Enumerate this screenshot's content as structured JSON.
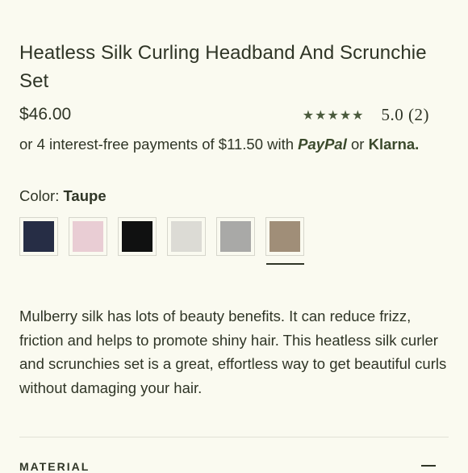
{
  "product": {
    "title": "Heatless Silk Curling Headband And Scrunchie Set",
    "price": "$46.00",
    "rating": {
      "stars": [
        "★",
        "★",
        "★",
        "★",
        "★"
      ],
      "text": "5.0 (2)",
      "star_color": "#4a5a3c"
    },
    "payments": {
      "prefix": "or 4 interest-free payments of $11.50 with ",
      "paypal": "PayPal",
      "middle": " or ",
      "klarna": "Klarna."
    },
    "color": {
      "label": "Color: ",
      "selected": "Taupe",
      "swatches": [
        {
          "name": "navy",
          "hex": "#262d45"
        },
        {
          "name": "pink",
          "hex": "#e9cdd4"
        },
        {
          "name": "black",
          "hex": "#101111"
        },
        {
          "name": "ivory",
          "hex": "#dcdbd5"
        },
        {
          "name": "grey",
          "hex": "#a9a9a7"
        },
        {
          "name": "taupe",
          "hex": "#a08e78"
        }
      ]
    },
    "description": "Mulberry silk has lots of beauty benefits. It can reduce frizz, friction and helps to promote shiny hair. This heatless silk curler and scrunchies set is a great, effortless way to get beautiful curls without damaging your hair.",
    "sections": {
      "material": "MATERIAL"
    }
  },
  "theme": {
    "background": "#fafaf0",
    "text": "#2f3526"
  }
}
